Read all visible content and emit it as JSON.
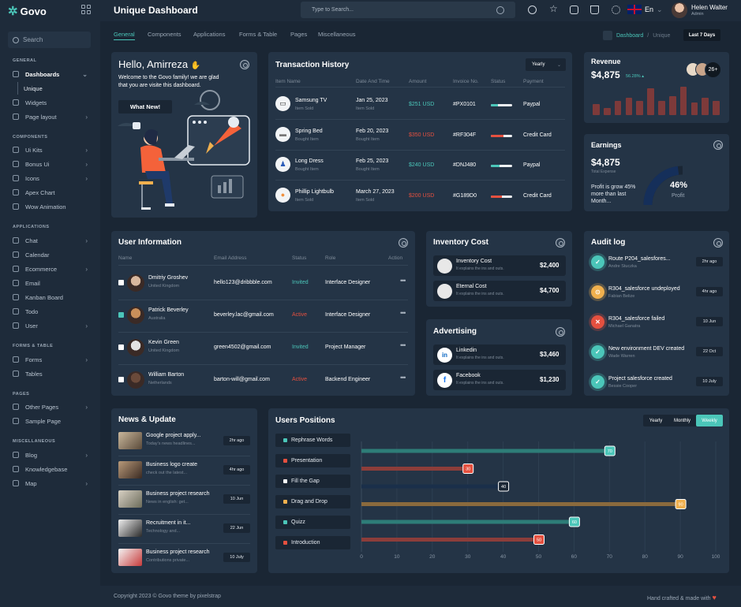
{
  "app": {
    "name": "Govo"
  },
  "page": {
    "title": "Unique Dashboard"
  },
  "colors": {
    "accent": "#4bc6b9",
    "danger": "#e5503f",
    "warning": "#f0b04e",
    "background": "#1a2634",
    "card": "#243446"
  },
  "sidebar": {
    "search_label": "Search",
    "sections": {
      "general": "GENERAL",
      "components": "COMPONENTS",
      "applications": "APPLICATIONS",
      "forms": "FORMS & TABLE",
      "pages": "PAGES",
      "misc": "MISCELLANEOUS"
    },
    "items": {
      "dashboards": "Dashboards",
      "unique": "Unique",
      "widgets": "Widgets",
      "page_layout": "Page layout",
      "ui_kits": "Ui Kits",
      "bonus_ui": "Bonus Ui",
      "icons": "Icons",
      "apex_chart": "Apex Chart",
      "wow_animation": "Wow Animation",
      "chat": "Chat",
      "calendar": "Calendar",
      "ecommerce": "Ecommerce",
      "email": "Email",
      "kanban": "Kanban Board",
      "todo": "Todo",
      "user": "User",
      "forms": "Forms",
      "tables": "Tables",
      "other_pages": "Other Pages",
      "sample_page": "Sample Page",
      "blog": "Blog",
      "knowledgebase": "Knowledgebase",
      "map": "Map"
    }
  },
  "topbar": {
    "search_placeholder": "Type to Search...",
    "language": "En",
    "user_name": "Helen Walter",
    "user_role": "Admin"
  },
  "tabs": [
    "General",
    "Components",
    "Applications",
    "Forms & Table",
    "Pages",
    "Miscellaneous"
  ],
  "breadcrumb": {
    "dashboard": "Dashboard",
    "current": "Unique"
  },
  "range_button": "Last 7 Days",
  "welcome": {
    "title": "Hello, Amirreza",
    "text_line1": "Welcome to the Govo family! we are glad",
    "text_line2": "that you are visite this dashboard.",
    "button": "What New!"
  },
  "transactions": {
    "title": "Transaction History",
    "filter": "Yearly",
    "headers": [
      "Item Name",
      "Date And Time",
      "Amount",
      "Invoice No.",
      "Status",
      "Payment"
    ],
    "rows": [
      {
        "name": "Samsung TV",
        "sub": "Item Sold",
        "date": "Jan 25, 2023",
        "time": "Item Sold",
        "amount": "$251 USD",
        "invoice": "#PX0101",
        "payment": "Paypal",
        "status_pct": 0.35,
        "status_color": "#4bc6b9",
        "amount_color": "#4bc6b9",
        "icon": "tv-icon"
      },
      {
        "name": "Spring Bed",
        "sub": "Bought Item",
        "date": "Feb 20, 2023",
        "time": "Bought Item",
        "amount": "$350 USD",
        "invoice": "#RF304F",
        "payment": "Credit Card",
        "status_pct": 0.6,
        "status_color": "#e5503f",
        "amount_color": "#e5503f",
        "icon": "bed-icon"
      },
      {
        "name": "Long Dress",
        "sub": "Bought Item",
        "date": "Feb 25, 2023",
        "time": "Bought Item",
        "amount": "$240 USD",
        "invoice": "#DNJ480",
        "payment": "Paypal",
        "status_pct": 0.4,
        "status_color": "#4bc6b9",
        "amount_color": "#4bc6b9",
        "icon": "dress-icon"
      },
      {
        "name": "Phillip Lightbulb",
        "sub": "Item Sold",
        "date": "March 27, 2023",
        "time": "Item Sold",
        "amount": "$200 USD",
        "invoice": "#G189D0",
        "payment": "Credit Card",
        "status_pct": 0.5,
        "status_color": "#e5503f",
        "amount_color": "#e5503f",
        "icon": "lightbulb-icon"
      }
    ]
  },
  "revenue": {
    "title": "Revenue",
    "value": "$4,875",
    "change": "56.28%",
    "avatars_more": "26+",
    "bars": [
      0.35,
      0.22,
      0.45,
      0.55,
      0.45,
      0.85,
      0.45,
      0.6,
      0.9,
      0.4,
      0.55,
      0.45
    ]
  },
  "earnings": {
    "title": "Earnings",
    "value": "$4,875",
    "label": "Total Expense",
    "text": "Profit is grow 45% more than last Month...",
    "percent": "46%",
    "percent_label": "Profit",
    "percent_value": 46
  },
  "users": {
    "title": "User Information",
    "headers": [
      "Name",
      "Email Address",
      "Status",
      "Role",
      "Action"
    ],
    "rows": [
      {
        "name": "Dmitriy Groshev",
        "country": "United Kingdom",
        "email": "hello123@dribbble.com",
        "status": "Invited",
        "role": "Interface Designer",
        "status_color": "#4bc6b9",
        "checked": false
      },
      {
        "name": "Patrick Beverley",
        "country": "Australia",
        "email": "beverley.lac@gmail.com",
        "status": "Active",
        "role": "Interface Designer",
        "status_color": "#e5503f",
        "checked": true
      },
      {
        "name": "Kevin Green",
        "country": "United Kingdom",
        "email": "green4502@gmail.com",
        "status": "Invited",
        "role": "Project Manager",
        "status_color": "#4bc6b9",
        "checked": false
      },
      {
        "name": "William Barton",
        "country": "Netherlands",
        "email": "barton-will@gmail.com",
        "status": "Active",
        "role": "Backend Engineer",
        "status_color": "#e5503f",
        "checked": false
      }
    ],
    "action_glyph": "•••"
  },
  "inventory": {
    "title": "Inventory Cost",
    "items": [
      {
        "name": "Inventory Cost",
        "sub": "It explains the ins and outs.",
        "value": "$2,400"
      },
      {
        "name": "Eternal Cost",
        "sub": "It explains the ins and outs.",
        "value": "$4,700"
      }
    ]
  },
  "advertising": {
    "title": "Advertising",
    "items": [
      {
        "name": "Linkedin",
        "sub": "It explains the ins and outs.",
        "value": "$3,460",
        "glyph": "in"
      },
      {
        "name": "Facebook",
        "sub": "It explains the ins and outs.",
        "value": "$1,230",
        "glyph": "f"
      }
    ]
  },
  "audit": {
    "title": "Audit log",
    "items": [
      {
        "title": "Route P204_salesfores...",
        "user": "Andre Stuczka",
        "date": "2hr ago",
        "color": "#4bc6b9",
        "glyph": "✓"
      },
      {
        "title": "R304_salesforce undeployed",
        "user": "Fabian Belize",
        "date": "4hr ago",
        "color": "#f0b04e",
        "glyph": "⊙"
      },
      {
        "title": "R304_salesforce failed",
        "user": "Michael Ganatra",
        "date": "10 Jun",
        "color": "#e5503f",
        "glyph": "✕"
      },
      {
        "title": "New environment DEV created",
        "user": "Wade Warren",
        "date": "22 Oct",
        "color": "#4bc6b9",
        "glyph": "✓"
      },
      {
        "title": "Project salesforce created",
        "user": "Bessie Cooper",
        "date": "10 July",
        "color": "#4bc6b9",
        "glyph": "✓"
      }
    ]
  },
  "news": {
    "title": "News & Update",
    "items": [
      {
        "title": "Google project apply...",
        "sub": "Today's news headlines...",
        "date": "2hr ago"
      },
      {
        "title": "Business logo create",
        "sub": "check out the latest...",
        "date": "4hr ago"
      },
      {
        "title": "Business project research",
        "sub": "News in english: get...",
        "date": "10 Jun"
      },
      {
        "title": "Recruitment in it...",
        "sub": "Technology and...",
        "date": "22 Jun"
      },
      {
        "title": "Business project research",
        "sub": "Contributions private...",
        "date": "10 July"
      }
    ]
  },
  "positions": {
    "title": "Users Positions",
    "toggles": [
      "Yearly",
      "Monthly",
      "Weekly"
    ],
    "tags": [
      {
        "label": "Rephrase Words",
        "color": "#4bc6b9"
      },
      {
        "label": "Presentation",
        "color": "#e5503f"
      },
      {
        "label": "Fill the Gap",
        "color": "#ffffff"
      },
      {
        "label": "Drag and Drop",
        "color": "#f0b04e"
      },
      {
        "label": "Quizz",
        "color": "#4bc6b9"
      },
      {
        "label": "Introduction",
        "color": "#e5503f"
      }
    ]
  },
  "chart_data": {
    "type": "bar",
    "orientation": "horizontal",
    "categories": [
      "Rephrase Words",
      "Presentation",
      "Fill the Gap",
      "Drag and Drop",
      "Quizz",
      "Introduction"
    ],
    "values": [
      70,
      30,
      40,
      90,
      60,
      50
    ],
    "bar_colors": [
      "#2e7d78",
      "#8c3d3a",
      "#1a2f4a",
      "#8a6a3d",
      "#2e7d78",
      "#8c3d3a"
    ],
    "label_colors": [
      "#4bc6b9",
      "#e5503f",
      "#1a2634",
      "#f0b04e",
      "#4bc6b9",
      "#e5503f"
    ],
    "xlim": [
      0,
      100
    ],
    "xticks": [
      "0",
      "10",
      "20",
      "30",
      "40",
      "50",
      "60",
      "70",
      "80",
      "90",
      "100"
    ],
    "grid": true
  },
  "footer": {
    "copyright": "Copyright 2023 © Govo theme by pixelstrap",
    "credit": "Hand crafted & made with"
  }
}
